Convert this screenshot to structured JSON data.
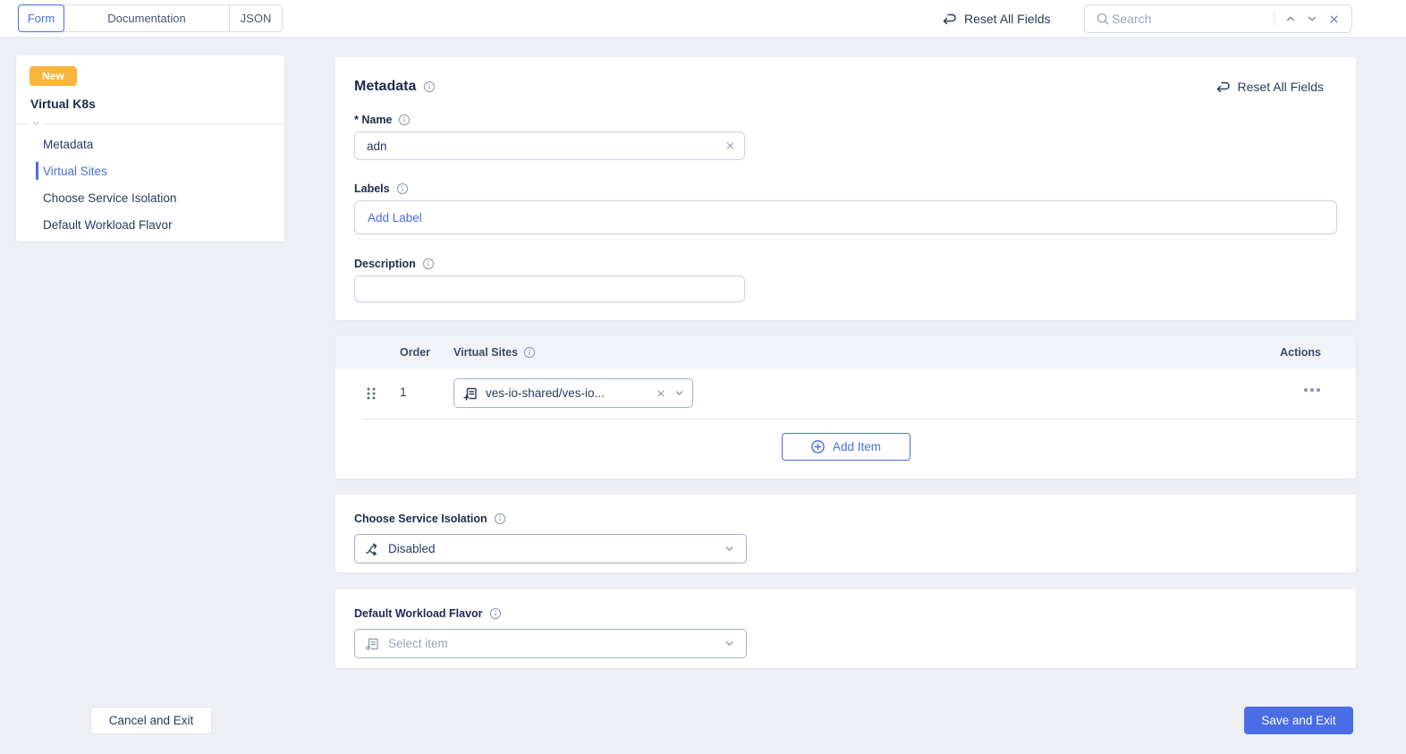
{
  "colors": {
    "accent_blue": "#4A6DE5",
    "navy_text": "#1E2A4E",
    "body_text": "#2B3A5C",
    "muted_gray": "#9AA3B5",
    "badge_orange": "#F9B43A",
    "page_bg": "#EDEFF4",
    "table_header_bg": "#F1F3F8"
  },
  "icons": {
    "reset": "undo-arrow",
    "search": "magnifier",
    "info": "circled-i",
    "clear": "x-mark",
    "expand": "chevron-down",
    "prev": "chevron-up",
    "drag": "six-dot-grid",
    "reference": "list-plus",
    "isolation": "branch-arrows",
    "add": "plus-circle",
    "more": "three-dots"
  },
  "topbar": {
    "tabs": [
      {
        "label": "Form",
        "active": true
      },
      {
        "label": "Documentation",
        "active": false
      },
      {
        "label": "JSON",
        "active": false
      }
    ],
    "reset_label": "Reset All Fields",
    "search": {
      "placeholder": "Search"
    }
  },
  "sidebar": {
    "badge": "New",
    "title": "Virtual K8s",
    "items": [
      {
        "label": "Metadata",
        "active": false
      },
      {
        "label": "Virtual Sites",
        "active": true
      },
      {
        "label": "Choose Service Isolation",
        "active": false
      },
      {
        "label": "Default Workload Flavor",
        "active": false
      }
    ]
  },
  "metadata_card": {
    "title": "Metadata",
    "reset_label": "Reset All Fields",
    "name": {
      "label": "* Name",
      "value": "adn"
    },
    "labels": {
      "label": "Labels",
      "add_button": "Add Label"
    },
    "description": {
      "label": "Description",
      "value": ""
    }
  },
  "virtual_sites_card": {
    "columns": {
      "order": "Order",
      "virtual_sites": "Virtual Sites",
      "actions": "Actions"
    },
    "rows": [
      {
        "order": "1",
        "value": "ves-io-shared/ves-io..."
      }
    ],
    "add_item_label": "Add Item"
  },
  "service_isolation_card": {
    "label": "Choose Service Isolation",
    "value": "Disabled"
  },
  "workload_flavor_card": {
    "label": "Default Workload Flavor",
    "placeholder": "Select item"
  },
  "footer": {
    "cancel_label": "Cancel and Exit",
    "save_label": "Save and Exit"
  }
}
